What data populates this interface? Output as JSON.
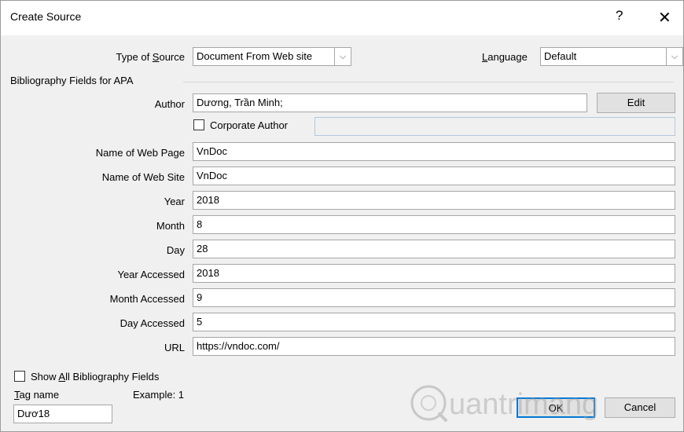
{
  "window": {
    "title": "Create Source",
    "help": "?",
    "close": "✕"
  },
  "type_of_source": {
    "label_pre": "Type of ",
    "label_key": "S",
    "label_post": "ource",
    "value": "Document From Web site"
  },
  "language": {
    "label_key": "L",
    "label_post": "anguage",
    "value": "Default"
  },
  "group_label": "Bibliography Fields for APA",
  "author": {
    "label": "Author",
    "value": "Dương, Trần Minh;",
    "edit": "Edit"
  },
  "corporate_author": {
    "label": "Corporate Author",
    "value": ""
  },
  "fields": [
    {
      "label": "Name of Web Page",
      "value": "VnDoc"
    },
    {
      "label": "Name of Web Site",
      "value": "VnDoc"
    },
    {
      "label": "Year",
      "value": "2018"
    },
    {
      "label": "Month",
      "value": "8"
    },
    {
      "label": "Day",
      "value": "28"
    },
    {
      "label": "Year Accessed",
      "value": "2018"
    },
    {
      "label": "Month Accessed",
      "value": "9"
    },
    {
      "label": "Day Accessed",
      "value": "5"
    },
    {
      "label": "URL",
      "value": "https://vndoc.com/"
    }
  ],
  "show_all": {
    "label_pre": "Show ",
    "label_key": "A",
    "label_post": "ll Bibliography Fields"
  },
  "tag": {
    "label_key": "T",
    "label_post": "ag name",
    "example": "Example: 1",
    "value": "Dươ18"
  },
  "buttons": {
    "ok": "OK",
    "cancel": "Cancel"
  },
  "watermark": {
    "text": "uantrimang"
  }
}
